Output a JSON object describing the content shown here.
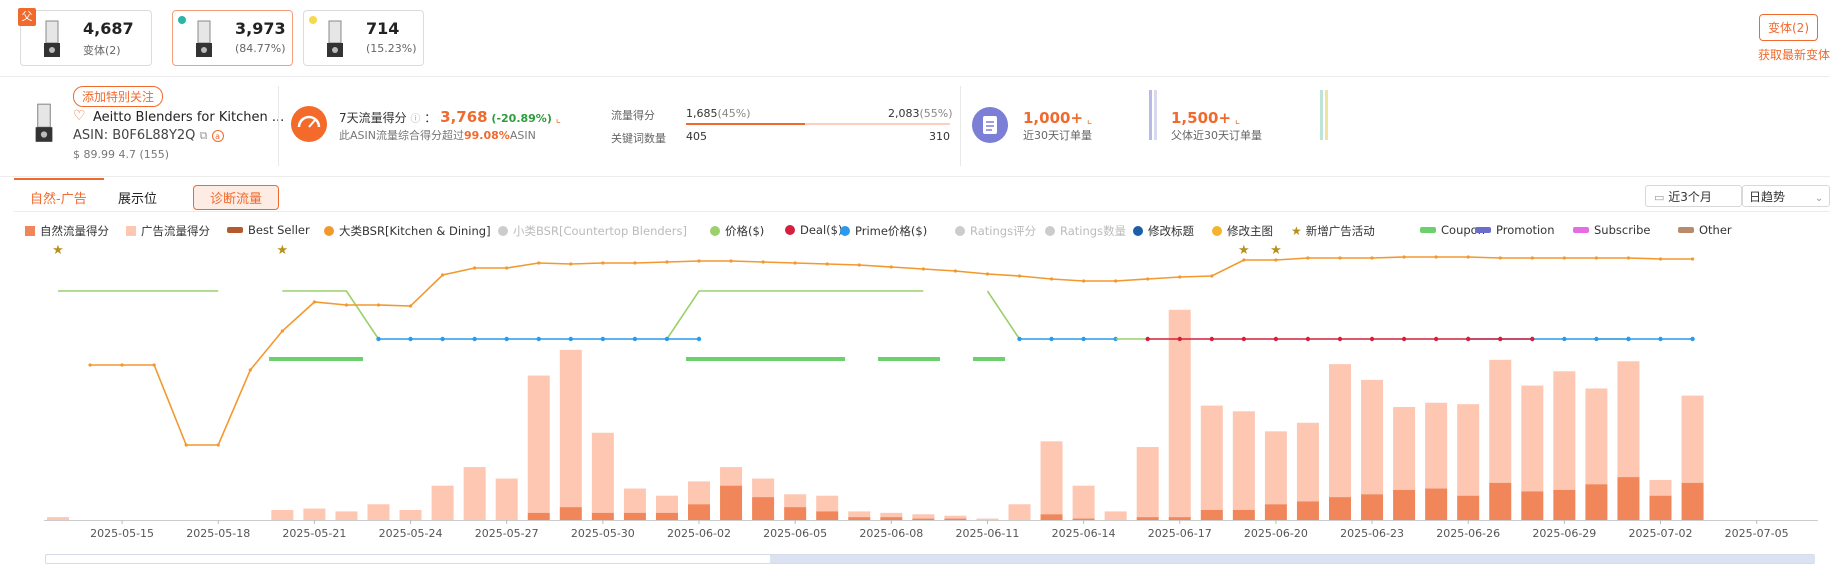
{
  "parent_badge": "父",
  "variants": [
    {
      "count": "4,687",
      "sub": "变体(2)",
      "dot": null,
      "active": false
    },
    {
      "count": "3,973",
      "sub": "(84.77%)",
      "dot": "#2bb5a5",
      "active": true
    },
    {
      "count": "714",
      "sub": "(15.23%)",
      "dot": "#f7d84a",
      "active": false
    }
  ],
  "variant_button": "变体(2)",
  "latest_variant_link": "获取最新变体",
  "product": {
    "follow_button": "添加特别关注",
    "title": "Aeitto Blenders for Kitchen ...",
    "asin_label": "ASIN:",
    "asin": "B0F6L88Y2Q",
    "price_rating": "$ 89.99 4.7 (155)"
  },
  "traffic": {
    "label": "7天流量得分",
    "score": "3,768",
    "change": "(-20.89%)",
    "desc_prefix": "此ASIN流量综合得分超过",
    "desc_pct": "99.08%",
    "desc_suffix": "ASIN",
    "flow_label": "流量得分",
    "flow_left": "1,685",
    "flow_left_pct": "(45%)",
    "flow_right": "2,083",
    "flow_right_pct": "(55%)",
    "flow_fraction": 0.45,
    "kw_label": "关键词数量",
    "kw_left": "405",
    "kw_right": "310"
  },
  "orders": {
    "value": "1,000+",
    "label": "近30天订单量",
    "parent_value": "1,500+",
    "parent_label": "父体近30天订单量"
  },
  "tabs": {
    "organic_ad": "自然-广告",
    "display": "展示位",
    "diagnose": "诊断流量"
  },
  "controls": {
    "range": "近3个月",
    "trend": "日趋势"
  },
  "legend": [
    {
      "label": "自然流量得分",
      "color": "#f0865a",
      "shape": "square",
      "active": true
    },
    {
      "label": "广告流量得分",
      "color": "#fdc7b2",
      "shape": "square",
      "active": true
    },
    {
      "label": "Best Seller",
      "color": "#b45a2d",
      "shape": "bar",
      "active": true
    },
    {
      "label": "大类BSR[Kitchen & Dining]",
      "color": "#f2992e",
      "shape": "circle",
      "active": true
    },
    {
      "label": "小类BSR[Countertop Blenders]",
      "color": "#cccccc",
      "shape": "circle",
      "active": false
    },
    {
      "label": "价格($)",
      "color": "#9bd06c",
      "shape": "circle",
      "active": true
    },
    {
      "label": "Deal($)",
      "color": "#d4203c",
      "shape": "circle",
      "active": true
    },
    {
      "label": "Prime价格($)",
      "color": "#2b9aec",
      "shape": "circle",
      "active": true
    },
    {
      "label": "Ratings评分",
      "color": "#cccccc",
      "shape": "circle",
      "active": false
    },
    {
      "label": "Ratings数量",
      "color": "#cccccc",
      "shape": "circle",
      "active": false
    },
    {
      "label": "修改标题",
      "color": "#1c5fa8",
      "shape": "circle",
      "active": true
    },
    {
      "label": "修改主图",
      "color": "#f4b42c",
      "shape": "circle",
      "active": true
    },
    {
      "label": "新增广告活动",
      "color": "#b8911d",
      "shape": "star",
      "active": true
    },
    {
      "label": "Coupon",
      "color": "#6cd06c",
      "shape": "bar",
      "active": true
    },
    {
      "label": "Promotion",
      "color": "#6a6ec8",
      "shape": "bar",
      "active": true
    },
    {
      "label": "Subscribe",
      "color": "#e66ce4",
      "shape": "bar",
      "active": true
    },
    {
      "label": "Other",
      "color": "#b88c6a",
      "shape": "bar",
      "active": true
    }
  ],
  "chart_data": {
    "type": "bar",
    "x_tick_labels": [
      "2025-05-15",
      "2025-05-18",
      "2025-05-21",
      "2025-05-24",
      "2025-05-27",
      "2025-05-30",
      "2025-06-02",
      "2025-06-05",
      "2025-06-08",
      "2025-06-11",
      "2025-06-14",
      "2025-06-17",
      "2025-06-20",
      "2025-06-23",
      "2025-06-26",
      "2025-06-29",
      "2025-07-02",
      "2025-07-05"
    ],
    "organic": [
      0,
      0,
      0,
      0,
      0,
      0,
      0,
      0,
      0,
      0,
      0,
      0,
      0,
      0,
      0,
      5,
      9,
      5,
      5,
      5,
      11,
      24,
      16,
      9,
      6,
      2,
      2,
      1,
      1,
      0,
      0,
      4,
      1,
      0,
      2,
      2,
      7,
      7,
      11,
      13,
      16,
      18,
      21,
      22,
      17,
      26,
      20,
      21,
      25,
      30,
      17,
      26
    ],
    "ads": [
      2,
      0,
      0,
      0,
      0,
      0,
      0,
      7,
      8,
      6,
      11,
      7,
      24,
      37,
      29,
      96,
      110,
      56,
      17,
      12,
      16,
      13,
      13,
      9,
      11,
      4,
      3,
      3,
      2,
      1,
      11,
      51,
      23,
      6,
      49,
      145,
      73,
      69,
      51,
      55,
      93,
      80,
      58,
      60,
      64,
      86,
      74,
      83,
      67,
      81,
      11,
      61
    ],
    "events": {
      "stars": [
        0,
        7,
        37,
        38
      ]
    }
  }
}
